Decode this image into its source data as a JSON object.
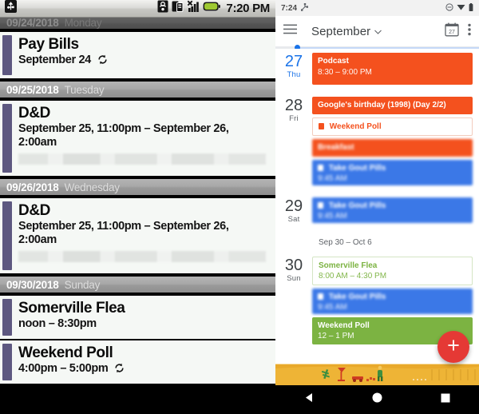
{
  "left_panel": {
    "status_bar": {
      "icons": [
        "usb-icon",
        "sd-card-icon",
        "sim-card-icon",
        "signal-no-service-icon",
        "battery-icon"
      ],
      "clock": "7:20 PM"
    },
    "agenda": {
      "groups": [
        {
          "date": "09/24/2018",
          "day": "Monday",
          "clipped": true,
          "events": [
            {
              "title": "Pay Bills",
              "subtitle": "September 24",
              "recurring": true,
              "redacted": false,
              "accent_color": "#5d5880"
            }
          ]
        },
        {
          "date": "09/25/2018",
          "day": "Tuesday",
          "clipped": false,
          "events": [
            {
              "title": "D&D",
              "subtitle": "September 25, 11:00pm – September 26, 2:00am",
              "recurring": false,
              "redacted": true,
              "accent_color": "#5d5880"
            }
          ]
        },
        {
          "date": "09/26/2018",
          "day": "Wednesday",
          "clipped": false,
          "events": [
            {
              "title": "D&D",
              "subtitle": "September 25, 11:00pm – September 26, 2:00am",
              "recurring": false,
              "redacted": true,
              "accent_color": "#5d5880"
            }
          ]
        },
        {
          "date": "09/30/2018",
          "day": "Sunday",
          "clipped": false,
          "events": [
            {
              "title": "Somerville Flea",
              "subtitle": "noon – 8:30pm",
              "recurring": false,
              "redacted": false,
              "accent_color": "#5d5880"
            },
            {
              "title": "Weekend Poll",
              "subtitle": "4:00pm – 5:00pm",
              "recurring": true,
              "redacted": false,
              "accent_color": "#5d5880"
            }
          ]
        }
      ]
    }
  },
  "right_panel": {
    "status_bar": {
      "time": "7:24",
      "icons": [
        "debug-icon",
        "do-not-disturb-icon",
        "wifi-icon",
        "battery-icon"
      ]
    },
    "app_bar": {
      "menu_icon": "hamburger-menu-icon",
      "title": "September",
      "dropdown_icon": "chevron-down-icon",
      "today_icon": "calendar-today-icon",
      "today_icon_label": "27",
      "overflow_icon": "overflow-menu-icon"
    },
    "days": [
      {
        "num": "27",
        "name": "Thu",
        "today": true,
        "events": [
          {
            "title": "Podcast",
            "time": "8:30 – 9:00 PM",
            "style": "filled",
            "color": "#F4511E",
            "blurred": false,
            "icon": false
          }
        ]
      },
      {
        "num": "28",
        "name": "Fri",
        "today": false,
        "events": [
          {
            "title": "Google's birthday (1998) (Day 2/2)",
            "time": "",
            "style": "filled",
            "color": "#F4511E",
            "blurred": false,
            "icon": false
          },
          {
            "title": "Weekend Poll",
            "time": "",
            "style": "outline",
            "color": "#F4511E",
            "blurred": false,
            "icon": true
          },
          {
            "title": "Breakfast",
            "time": "",
            "style": "filled",
            "color": "#F4511E",
            "blurred": true,
            "icon": false
          },
          {
            "title": "Take Gout Pills",
            "time": "9:45 AM",
            "style": "filled",
            "color": "#3B78E7",
            "blurred": true,
            "icon": true
          }
        ]
      },
      {
        "num": "29",
        "name": "Sat",
        "today": false,
        "events": [
          {
            "title": "Take Gout Pills",
            "time": "9:45 AM",
            "style": "filled",
            "color": "#3B78E7",
            "blurred": true,
            "icon": true
          }
        ]
      }
    ],
    "week_divider": "Sep 30 – Oct 6",
    "days2": [
      {
        "num": "30",
        "name": "Sun",
        "today": false,
        "events": [
          {
            "title": "Somerville Flea",
            "time": "8:00 AM – 4:30 PM",
            "style": "outline",
            "color": "#7CB342",
            "blurred": false,
            "icon": false
          },
          {
            "title": "Take Gout Pills",
            "time": "9:45 AM",
            "style": "filled",
            "color": "#3B78E7",
            "blurred": true,
            "icon": true
          },
          {
            "title": "Weekend Poll",
            "time": "12 – 1 PM",
            "style": "filled",
            "color": "#7CB342",
            "blurred": false,
            "icon": false
          }
        ]
      }
    ],
    "fab": {
      "icon": "plus-icon",
      "color": "#e53935"
    },
    "nav_bar": {
      "back_icon": "nav-back-icon",
      "home_icon": "nav-home-icon",
      "recents_icon": "nav-recents-icon"
    }
  }
}
